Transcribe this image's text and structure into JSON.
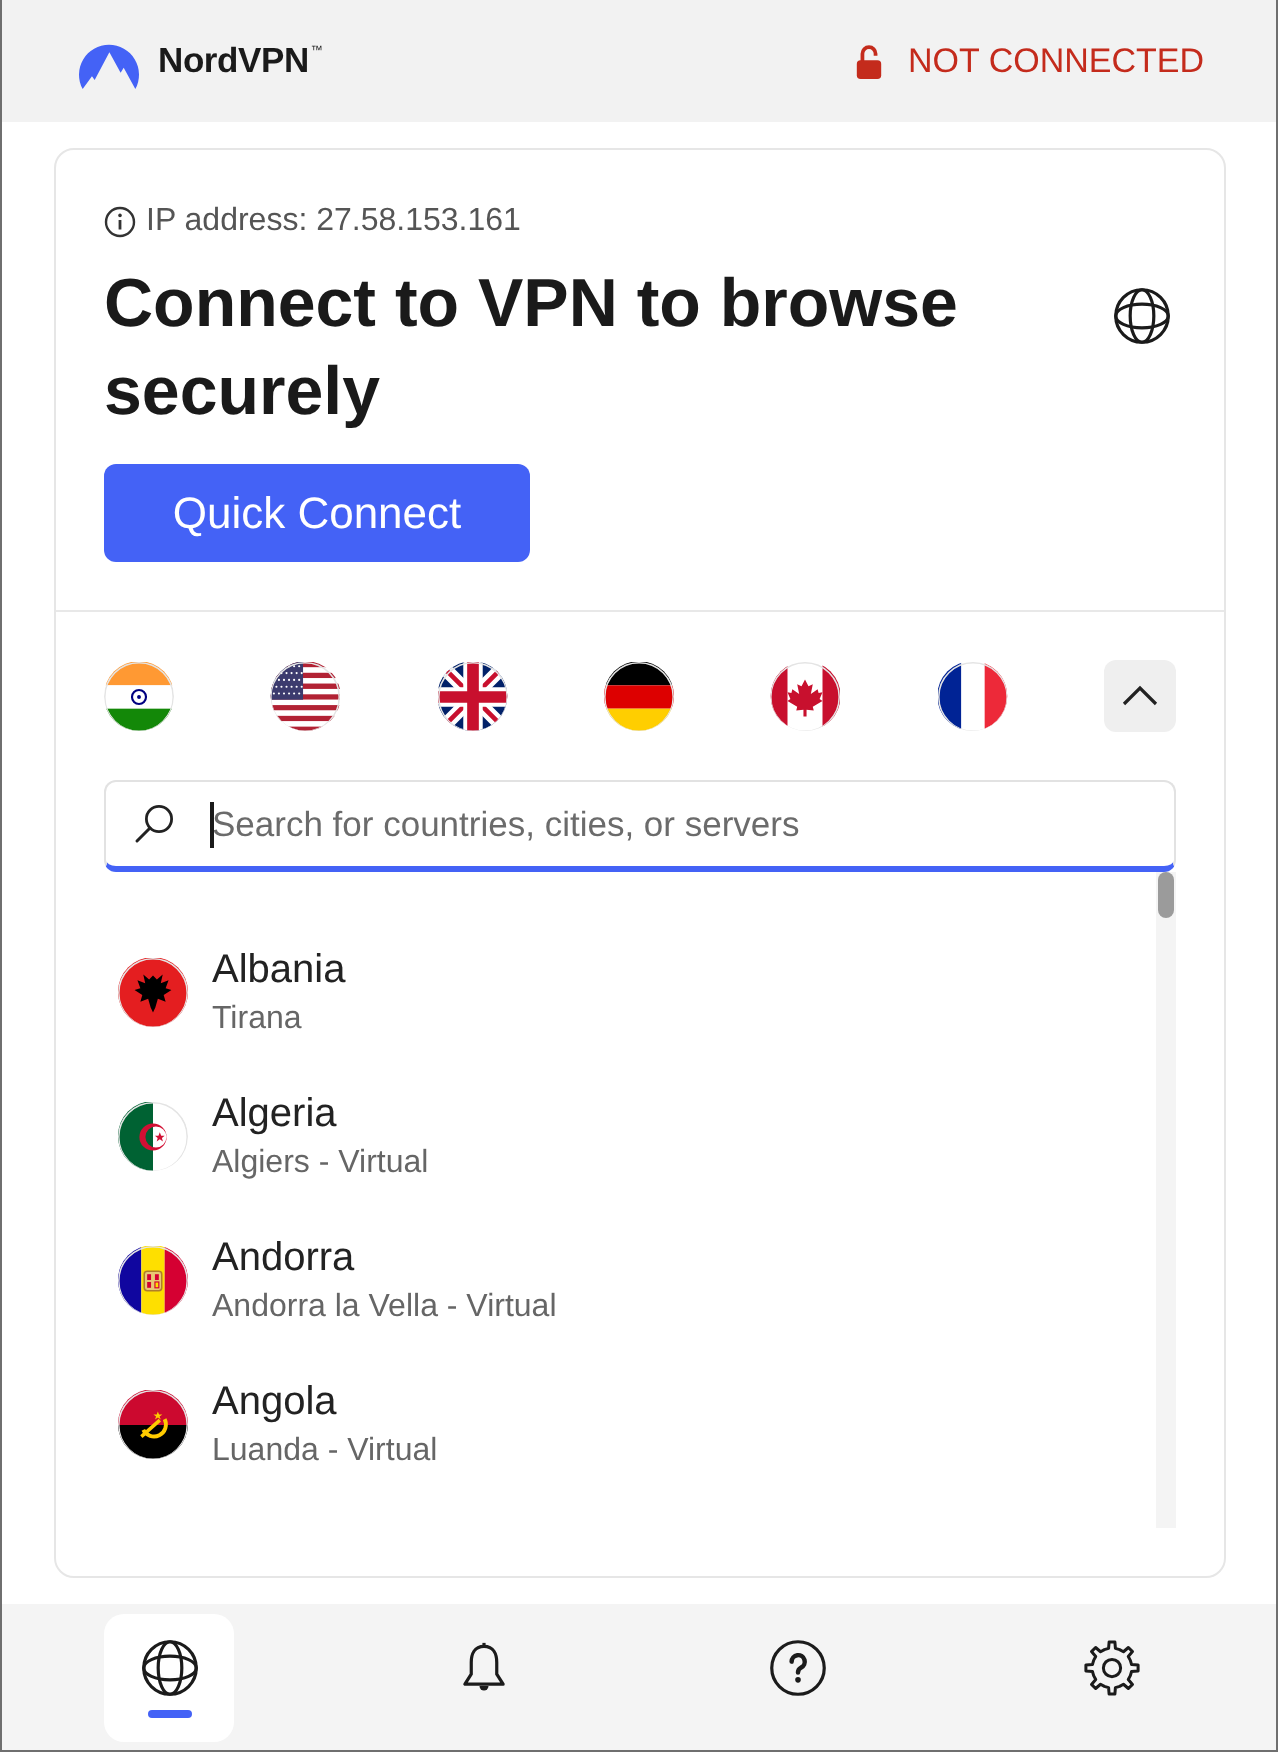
{
  "header": {
    "brand": "NordVPN$^{™}$",
    "status": {
      "label": "NOT CONNECTED",
      "connected": false
    }
  },
  "connect_card": {
    "ip_address": "IP address: 27.58.153.161",
    "heading": "Connect to VPN to browse securely",
    "button": "Quick Connect"
  },
  "quick_flags": {
    "expanded": true
  },
  "search": {
    "placeholder": "Search for countries, cities, or servers",
    "focused": true
  },
  "countries": [
    {
      "name": "Albania",
      "location": "Tirana"
    },
    {
      "name": "Algeria",
      "location": "Algiers - Virtual"
    },
    {
      "name": "Andorra",
      "location": "Andorra la Vella - Virtual"
    },
    {
      "name": "Angola",
      "location": "Luanda - Virtual"
    }
  ],
  "bottom_nav": [
    {
      "selected": true
    },
    {
      "selected": false
    },
    {
      "selected": false
    },
    {
      "selected": false
    }
  ]
}
